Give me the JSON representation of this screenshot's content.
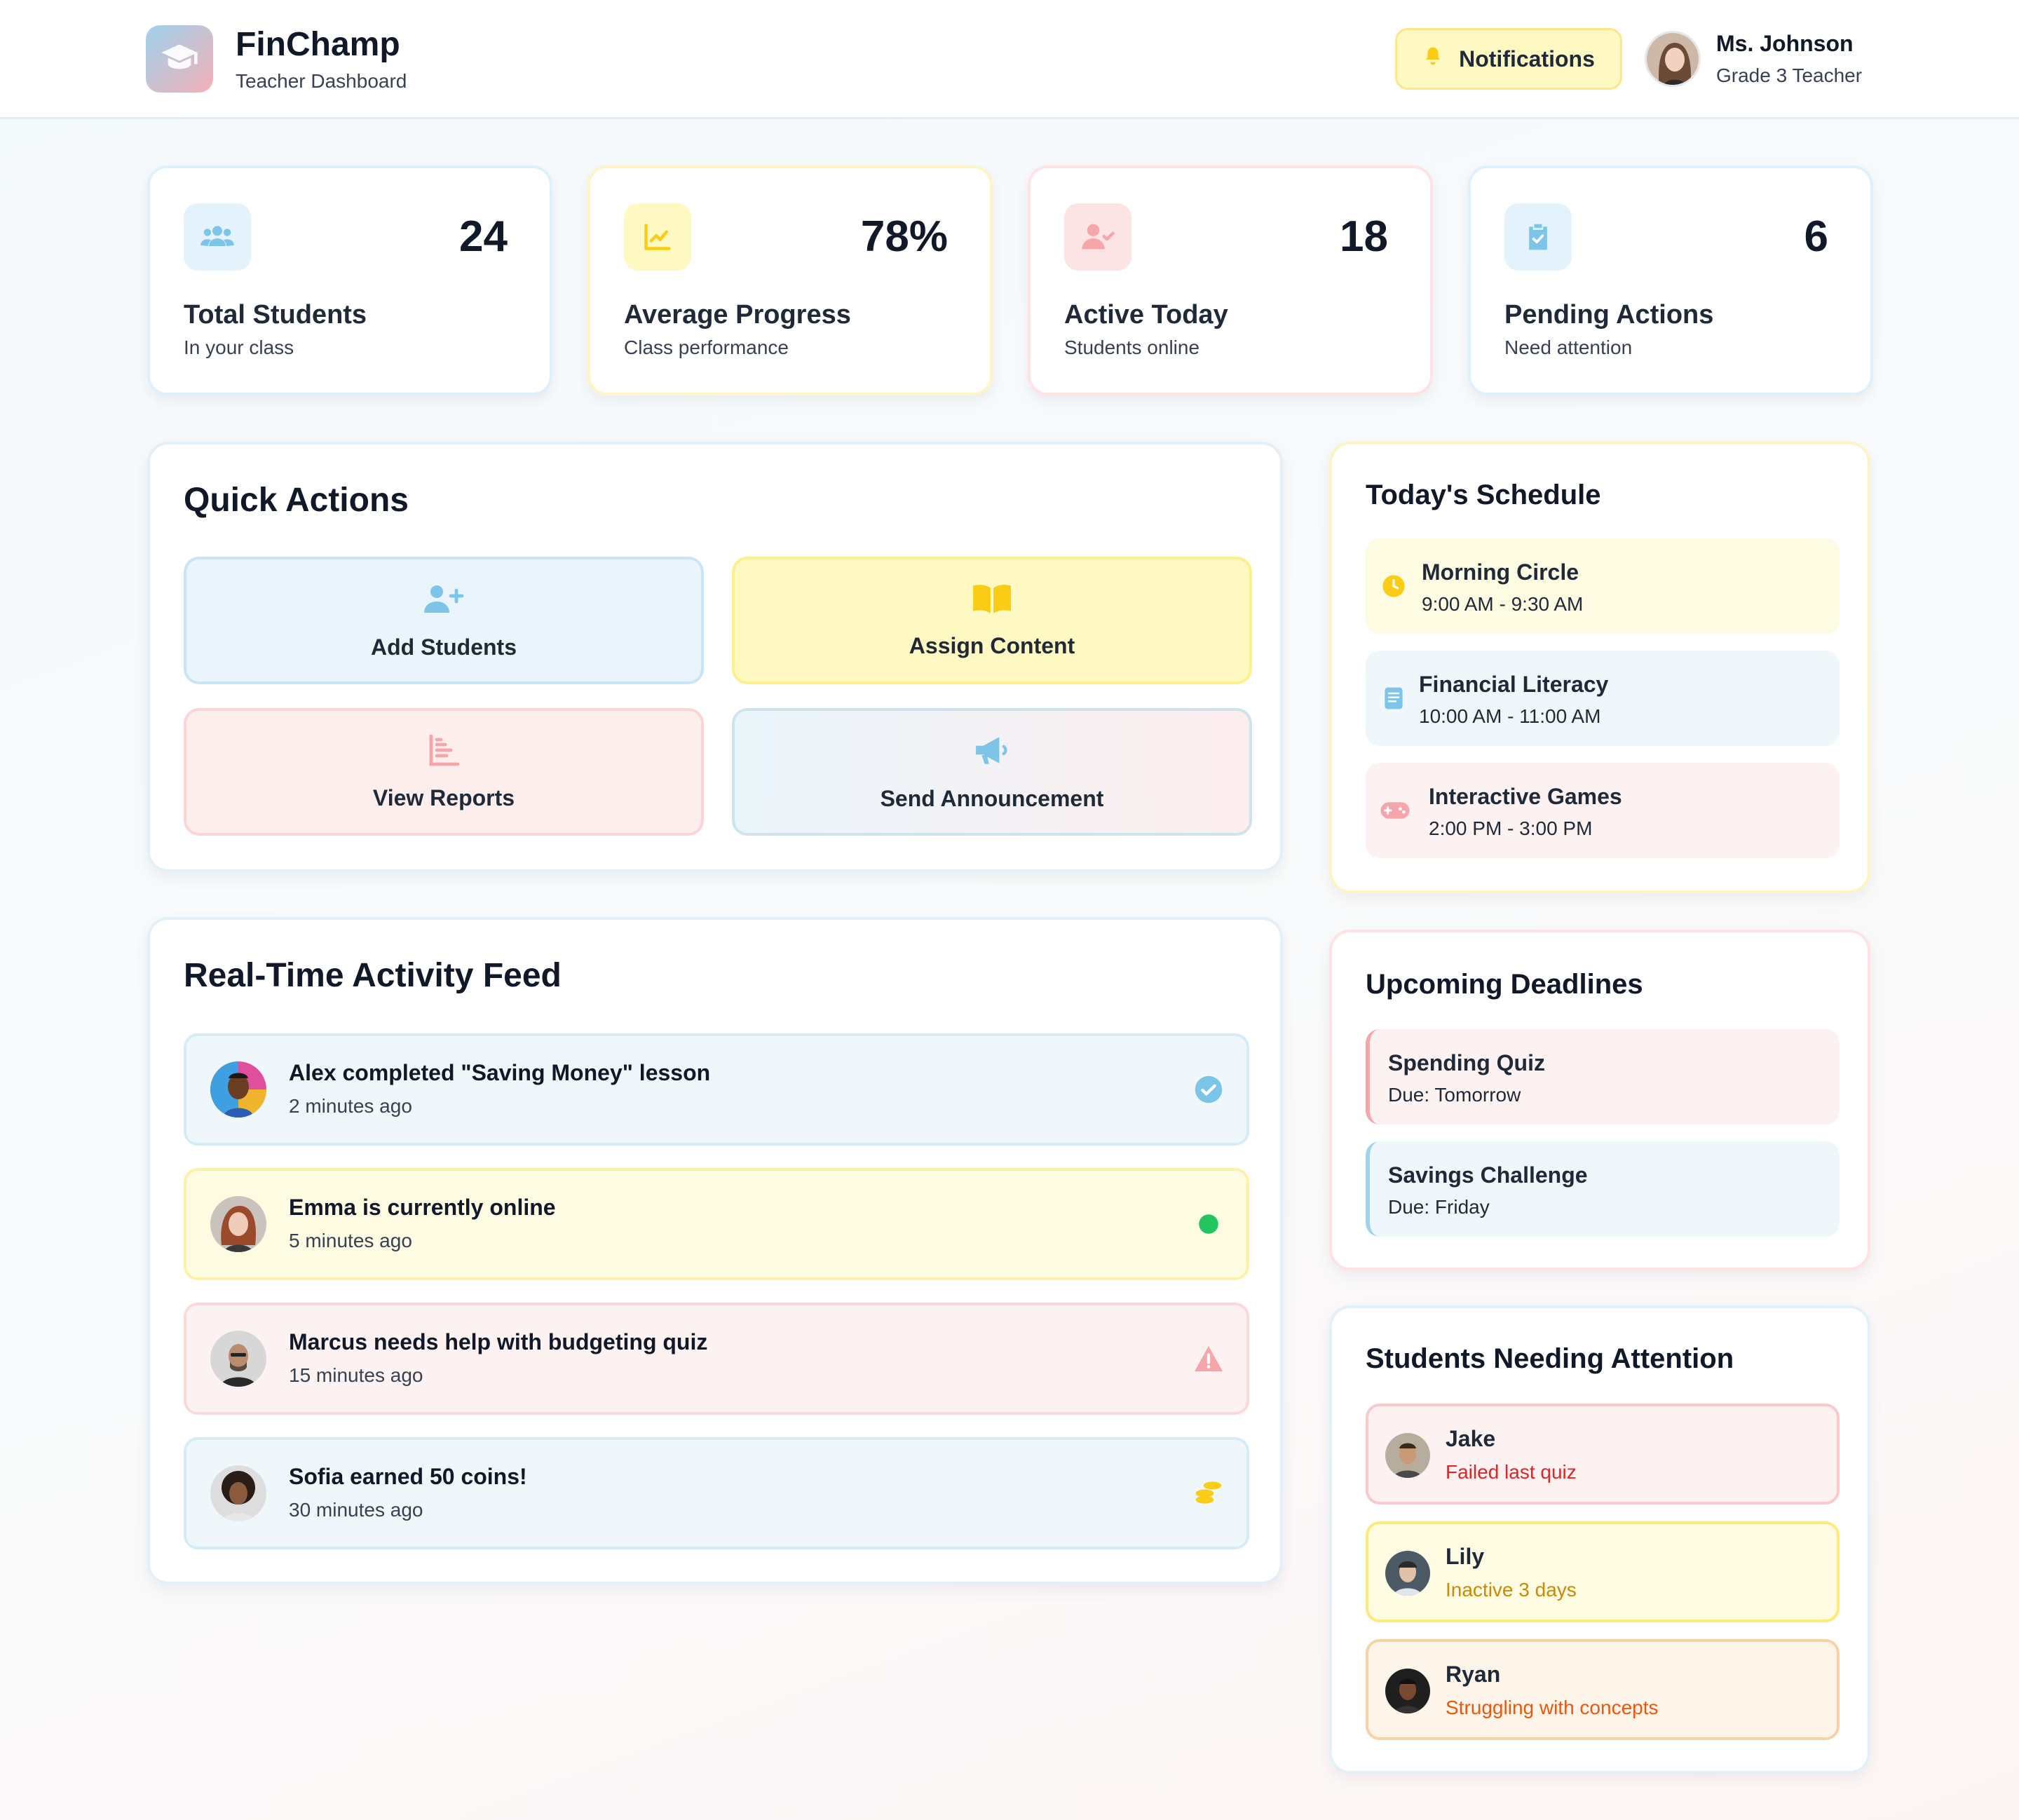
{
  "header": {
    "brand_name": "FinChamp",
    "brand_sub": "Teacher Dashboard",
    "notifications_label": "Notifications",
    "user_name": "Ms. Johnson",
    "user_role": "Grade 3 Teacher",
    "logo_icon": "graduation-cap-icon",
    "notifications_icon": "bell-icon"
  },
  "stats": [
    {
      "value": "24",
      "title": "Total Students",
      "sub": "In your class",
      "icon": "users-icon",
      "color": "#7cc4e8"
    },
    {
      "value": "78%",
      "title": "Average Progress",
      "sub": "Class performance",
      "icon": "chart-line-icon",
      "color": "#facc15"
    },
    {
      "value": "18",
      "title": "Active Today",
      "sub": "Students online",
      "icon": "user-check-icon",
      "color": "#f4a6aa"
    },
    {
      "value": "6",
      "title": "Pending Actions",
      "sub": "Need attention",
      "icon": "clipboard-check-icon",
      "color": "#7cc4e8"
    }
  ],
  "quick_actions": {
    "title": "Quick Actions",
    "items": [
      {
        "label": "Add Students",
        "icon": "user-plus-icon"
      },
      {
        "label": "Assign Content",
        "icon": "book-open-icon"
      },
      {
        "label": "View Reports",
        "icon": "chart-bar-icon"
      },
      {
        "label": "Send Announcement",
        "icon": "megaphone-icon"
      }
    ]
  },
  "activity_feed": {
    "title": "Real-Time Activity Feed",
    "items": [
      {
        "text": "Alex completed \"Saving Money\" lesson",
        "time": "2 minutes ago",
        "status_icon": "check-circle-icon"
      },
      {
        "text": "Emma is currently online",
        "time": "5 minutes ago",
        "status_icon": "online-dot-icon"
      },
      {
        "text": "Marcus needs help with budgeting quiz",
        "time": "15 minutes ago",
        "status_icon": "warning-icon"
      },
      {
        "text": "Sofia earned 50 coins!",
        "time": "30 minutes ago",
        "status_icon": "coins-icon"
      }
    ]
  },
  "schedule": {
    "title": "Today's Schedule",
    "items": [
      {
        "title": "Morning Circle",
        "time": "9:00 AM - 9:30 AM",
        "icon": "clock-icon"
      },
      {
        "title": "Financial Literacy",
        "time": "10:00 AM - 11:00 AM",
        "icon": "book-icon"
      },
      {
        "title": "Interactive Games",
        "time": "2:00 PM - 3:00 PM",
        "icon": "gamepad-icon"
      }
    ]
  },
  "deadlines": {
    "title": "Upcoming Deadlines",
    "items": [
      {
        "title": "Spending Quiz",
        "due": "Due: Tomorrow"
      },
      {
        "title": "Savings Challenge",
        "due": "Due: Friday"
      }
    ]
  },
  "attention": {
    "title": "Students Needing Attention",
    "items": [
      {
        "name": "Jake",
        "note": "Failed last quiz",
        "color": "#dc2626"
      },
      {
        "name": "Lily",
        "note": "Inactive 3 days",
        "color": "#ca8a04"
      },
      {
        "name": "Ryan",
        "note": "Struggling with concepts",
        "color": "#ea580c"
      }
    ]
  }
}
